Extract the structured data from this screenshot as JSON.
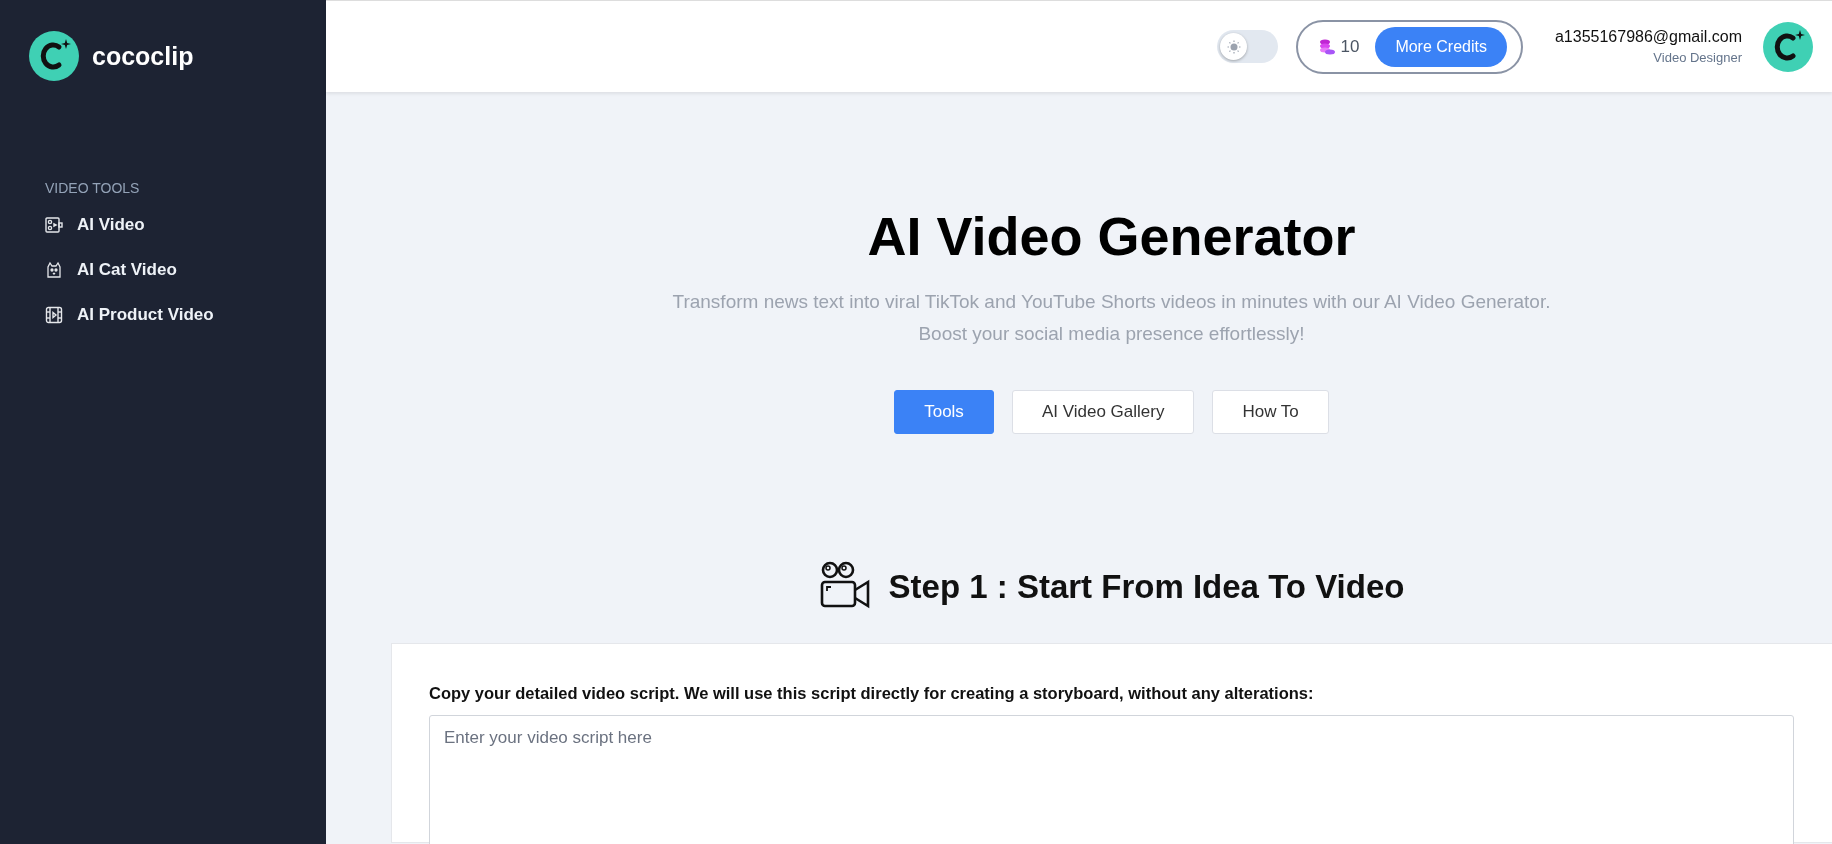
{
  "sidebar": {
    "logo_text": "cococlip",
    "section_title": "VIDEO TOOLS",
    "items": [
      {
        "label": "AI Video",
        "kind": "video"
      },
      {
        "label": "AI Cat Video",
        "kind": "cat"
      },
      {
        "label": "AI Product Video",
        "kind": "film"
      }
    ]
  },
  "header": {
    "theme_toggle": {
      "on": false
    },
    "credits": {
      "count": "10",
      "button": "More Credits"
    },
    "user": {
      "email": "a1355167986@gmail.com",
      "role": "Video Designer"
    }
  },
  "hero": {
    "title": "AI Video Generator",
    "subtitle": [
      "Transform news text into viral TikTok and YouTube Shorts videos in minutes with our AI Video Generator.",
      "Boost your social media presence effortlessly!"
    ]
  },
  "tabs": [
    {
      "label": "Tools",
      "selected": true
    },
    {
      "label": "AI Video Gallery",
      "selected": false
    },
    {
      "label": "How To",
      "selected": false
    }
  ],
  "step": {
    "title": "Step 1 : Start From Idea To Video",
    "script_label": "Copy your detailed video script. We will use this script directly for creating a storyboard, without any alterations:",
    "script_field": {
      "placeholder": "Enter your video script here"
    }
  }
}
